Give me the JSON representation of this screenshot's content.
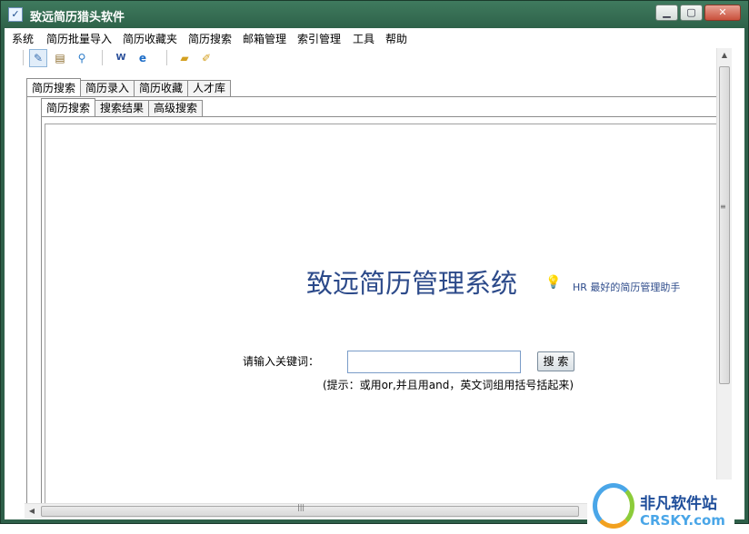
{
  "window": {
    "title": "致远简历猎头软件",
    "app_icon": "app-logo-icon",
    "min": "▁",
    "max": "▢",
    "close": "✕"
  },
  "menubar": {
    "items": [
      "系统",
      "简历批量导入",
      "简历收藏夹",
      "简历搜索",
      "邮箱管理",
      "索引管理",
      "工具",
      "帮助"
    ]
  },
  "toolbar": {
    "icons": [
      "edit-icon",
      "clipboard-icon",
      "search-icon",
      "word-icon",
      "ie-icon",
      "folder-icon",
      "pencil-icon"
    ]
  },
  "tabs_outer": [
    "简历搜索",
    "简历录入",
    "简历收藏",
    "人才库"
  ],
  "tabs_inner": [
    "简历搜索",
    "搜索结果",
    "高级搜索"
  ],
  "main": {
    "title": "致远简历管理系统",
    "tagline": "HR 最好的简历管理助手",
    "keyword_label": "请输入关键词：",
    "keyword_value": "",
    "search_button": "搜 索",
    "hint": "(提示：或用or,并且用and，英文词组用括号括起来)"
  },
  "watermark": {
    "cn": "非凡软件站",
    "en": "CRSKY.com"
  },
  "colors": {
    "titlebar": "#2e6249",
    "accent_text": "#2c4a8a"
  }
}
